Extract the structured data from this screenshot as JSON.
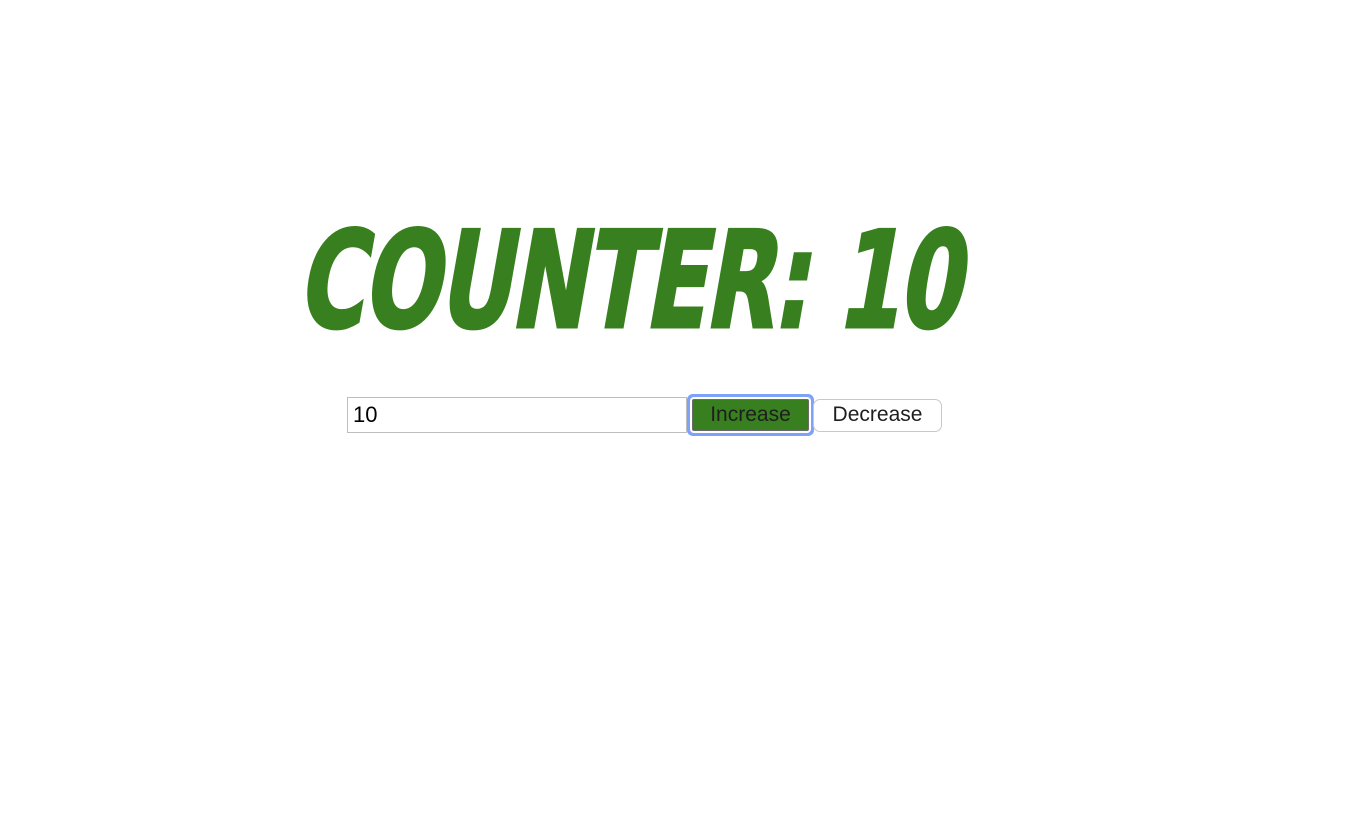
{
  "counter": {
    "title": "Counter: 10",
    "value": "10"
  },
  "buttons": {
    "increase_label": "Increase",
    "decrease_label": "Decrease"
  },
  "colors": {
    "accent": "#38801f",
    "focus_ring": "#7ea2f7"
  }
}
